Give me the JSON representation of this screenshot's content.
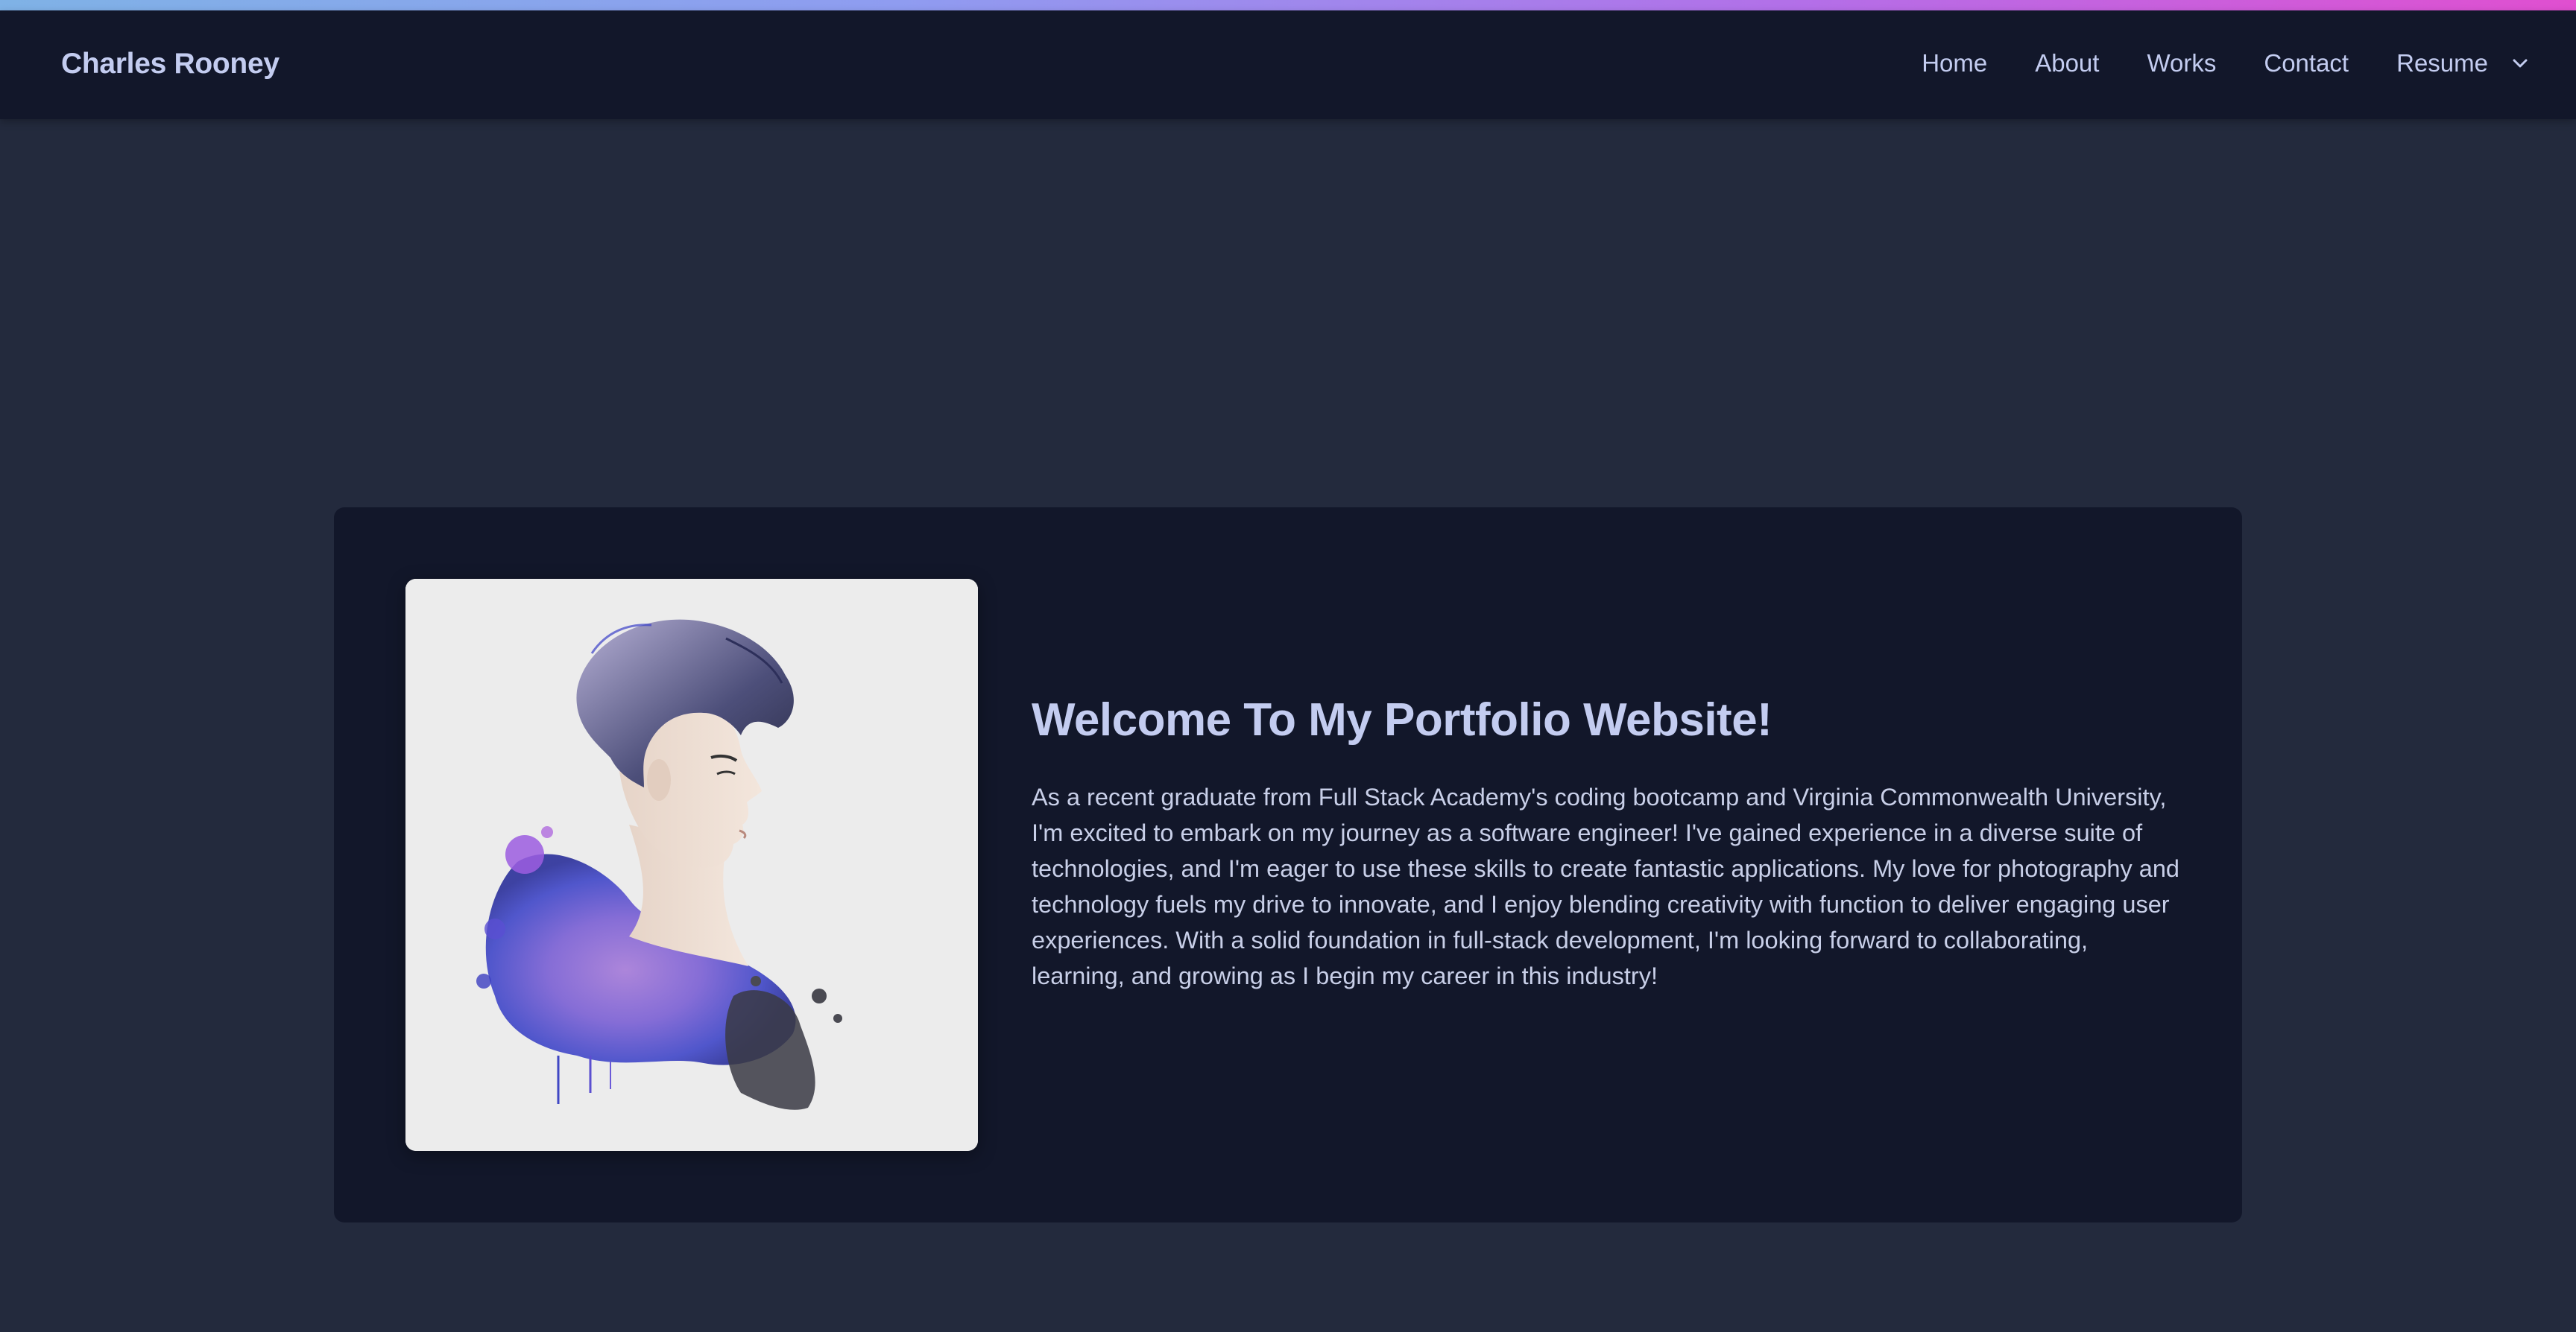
{
  "header": {
    "brand": "Charles Rooney",
    "nav": {
      "home": "Home",
      "about": "About",
      "works": "Works",
      "contact": "Contact",
      "resume": "Resume"
    }
  },
  "hero": {
    "heading": "Welcome To My Portfolio Website!",
    "paragraph": "As a recent graduate from Full Stack Academy's coding bootcamp and Virginia Commonwealth University, I'm excited to embark on my journey as a software engineer! I've gained experience in a diverse suite of technologies, and I'm eager to use these skills to create fantastic applications. My love for photography and technology fuels my drive to innovate, and I enjoy blending creativity with function to deliver engaging user experiences. With a solid foundation in full-stack development, I'm looking forward to collaborating, learning, and growing as I begin my career in this industry!"
  },
  "icons": {
    "resume_dropdown": "chevron-down-icon"
  },
  "colors": {
    "page_background": "#232a3d",
    "navbar_background": "#12172a",
    "card_background": "#12172a",
    "text_primary": "#c3ccf0",
    "accent_gradient_start": "#7fb2e6",
    "accent_gradient_end": "#e04fd0"
  }
}
